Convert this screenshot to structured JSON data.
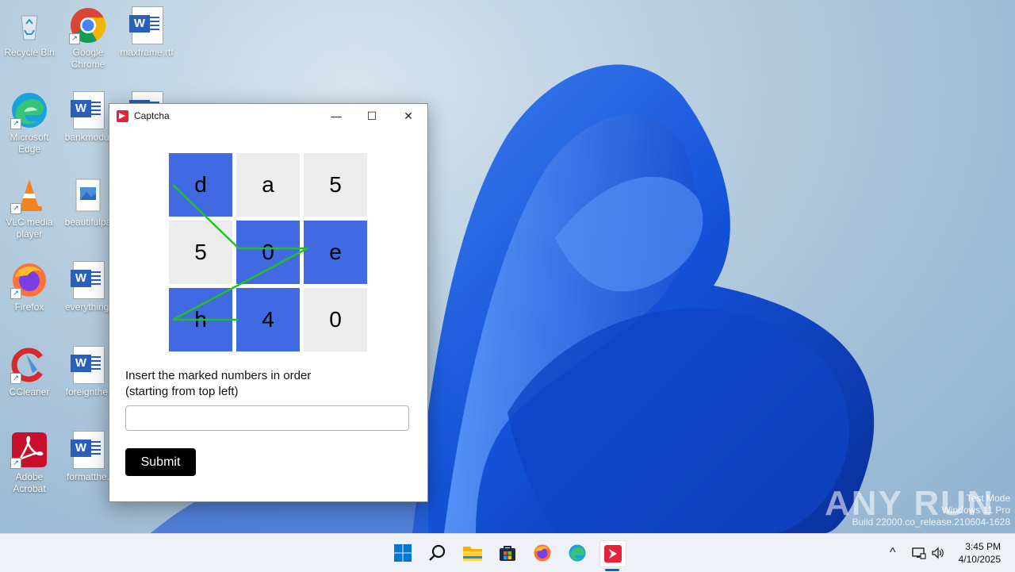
{
  "desktop": {
    "icons": [
      {
        "label": "Recycle Bin"
      },
      {
        "label": "Google Chrome"
      },
      {
        "label": "maxframe.rtf"
      },
      {
        "label": "Microsoft Edge"
      },
      {
        "label": "bankmodul"
      },
      {
        "label": "VLC media player"
      },
      {
        "label": "beautifulpa"
      },
      {
        "label": "Firefox"
      },
      {
        "label": "everythingj"
      },
      {
        "label": "CCleaner"
      },
      {
        "label": "foreignthe."
      },
      {
        "label": "Adobe Acrobat"
      },
      {
        "label": "formatthe."
      }
    ]
  },
  "window": {
    "title": "Captcha",
    "minimize_glyph": "—",
    "maximize_glyph": "☐",
    "close_glyph": "✕",
    "accent": "#e8213d"
  },
  "captcha": {
    "cells": [
      {
        "char": "d",
        "marked": true
      },
      {
        "char": "a",
        "marked": false
      },
      {
        "char": "5",
        "marked": false
      },
      {
        "char": "5",
        "marked": false
      },
      {
        "char": "0",
        "marked": true
      },
      {
        "char": "e",
        "marked": true
      },
      {
        "char": "h",
        "marked": true
      },
      {
        "char": "4",
        "marked": true
      },
      {
        "char": "0",
        "marked": false
      }
    ],
    "marked_color": "#4169e1",
    "plain_color": "#ececec",
    "line_color": "#22c022",
    "instruction_line1": "Insert the marked numbers in order",
    "instruction_line2": "(starting from top left)",
    "input_value": "",
    "submit_label": "Submit"
  },
  "watermark": {
    "line1": "Test Mode",
    "line2": "Windows 11 Pro",
    "line3": "Build 22000.co_release.210604-1628",
    "brand": "ANY RUN"
  },
  "taskbar": {
    "icons": [
      "windows-start-icon",
      "search-icon",
      "file-explorer-icon",
      "store-icon",
      "firefox-icon",
      "edge-icon",
      "captcha-app-icon"
    ],
    "tray_chevron": "^",
    "time": "3:45 PM",
    "date": "4/10/2025"
  }
}
